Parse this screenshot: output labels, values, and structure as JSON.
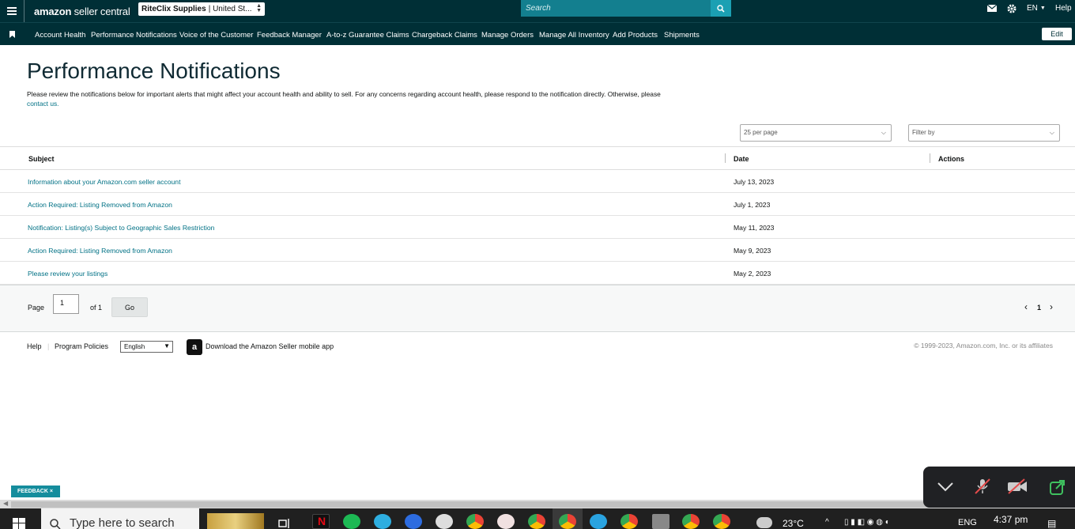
{
  "topbar": {
    "logo_amazon": "amazon",
    "logo_rest": "seller central",
    "account_name": "RiteClix Supplies",
    "account_region": "| United St...",
    "search_placeholder": "Search",
    "language": "EN",
    "help": "Help"
  },
  "nav": {
    "items": [
      "Account Health",
      "Performance Notifications",
      "Voice of the Customer",
      "Feedback Manager",
      "A-to-z Guarantee Claims",
      "Chargeback Claims",
      "Manage Orders",
      "Manage All Inventory",
      "Add Products",
      "Shipments"
    ],
    "edit_label": "Edit"
  },
  "page": {
    "title": "Performance Notifications",
    "description": "Please review the notifications below for important alerts that might affect your account health and ability to sell. For any concerns regarding account health, please respond to the notification directly. Otherwise, please",
    "contact_link": "contact us."
  },
  "filters": {
    "per_page": "25 per page",
    "filter_by": "Filter by"
  },
  "table": {
    "headers": {
      "subject": "Subject",
      "date": "Date",
      "actions": "Actions"
    },
    "rows": [
      {
        "subject": "Information about your Amazon.com seller account",
        "date": "July 13, 2023"
      },
      {
        "subject": "Action Required: Listing Removed from Amazon",
        "date": "July 1, 2023"
      },
      {
        "subject": "Notification: Listing(s) Subject to Geographic Sales Restriction",
        "date": "May 11, 2023"
      },
      {
        "subject": "Action Required: Listing Removed from Amazon",
        "date": "May 9, 2023"
      },
      {
        "subject": "Please review your listings",
        "date": "May 2, 2023"
      }
    ]
  },
  "pager": {
    "page_label": "Page",
    "page_value": "1",
    "of_label": "of 1",
    "go_label": "Go",
    "current": "1",
    "prev": "‹",
    "next": "›"
  },
  "footer": {
    "help": "Help",
    "program_policies": "Program Policies",
    "language": "English",
    "app_text": "Download the Amazon Seller mobile app",
    "app_icon_letter": "a",
    "copyright": "© 1999-2023, Amazon.com, Inc. or its affiliates"
  },
  "feedback": "FEEDBACK ×",
  "taskbar": {
    "search_placeholder": "Type here to search",
    "weather": "23°C",
    "lang": "ENG",
    "time": "4:37 pm"
  },
  "colors": {
    "header_bg": "#002f36",
    "link": "#007185",
    "search_bg": "#137f8f",
    "feedback_bg": "#158d9d"
  }
}
